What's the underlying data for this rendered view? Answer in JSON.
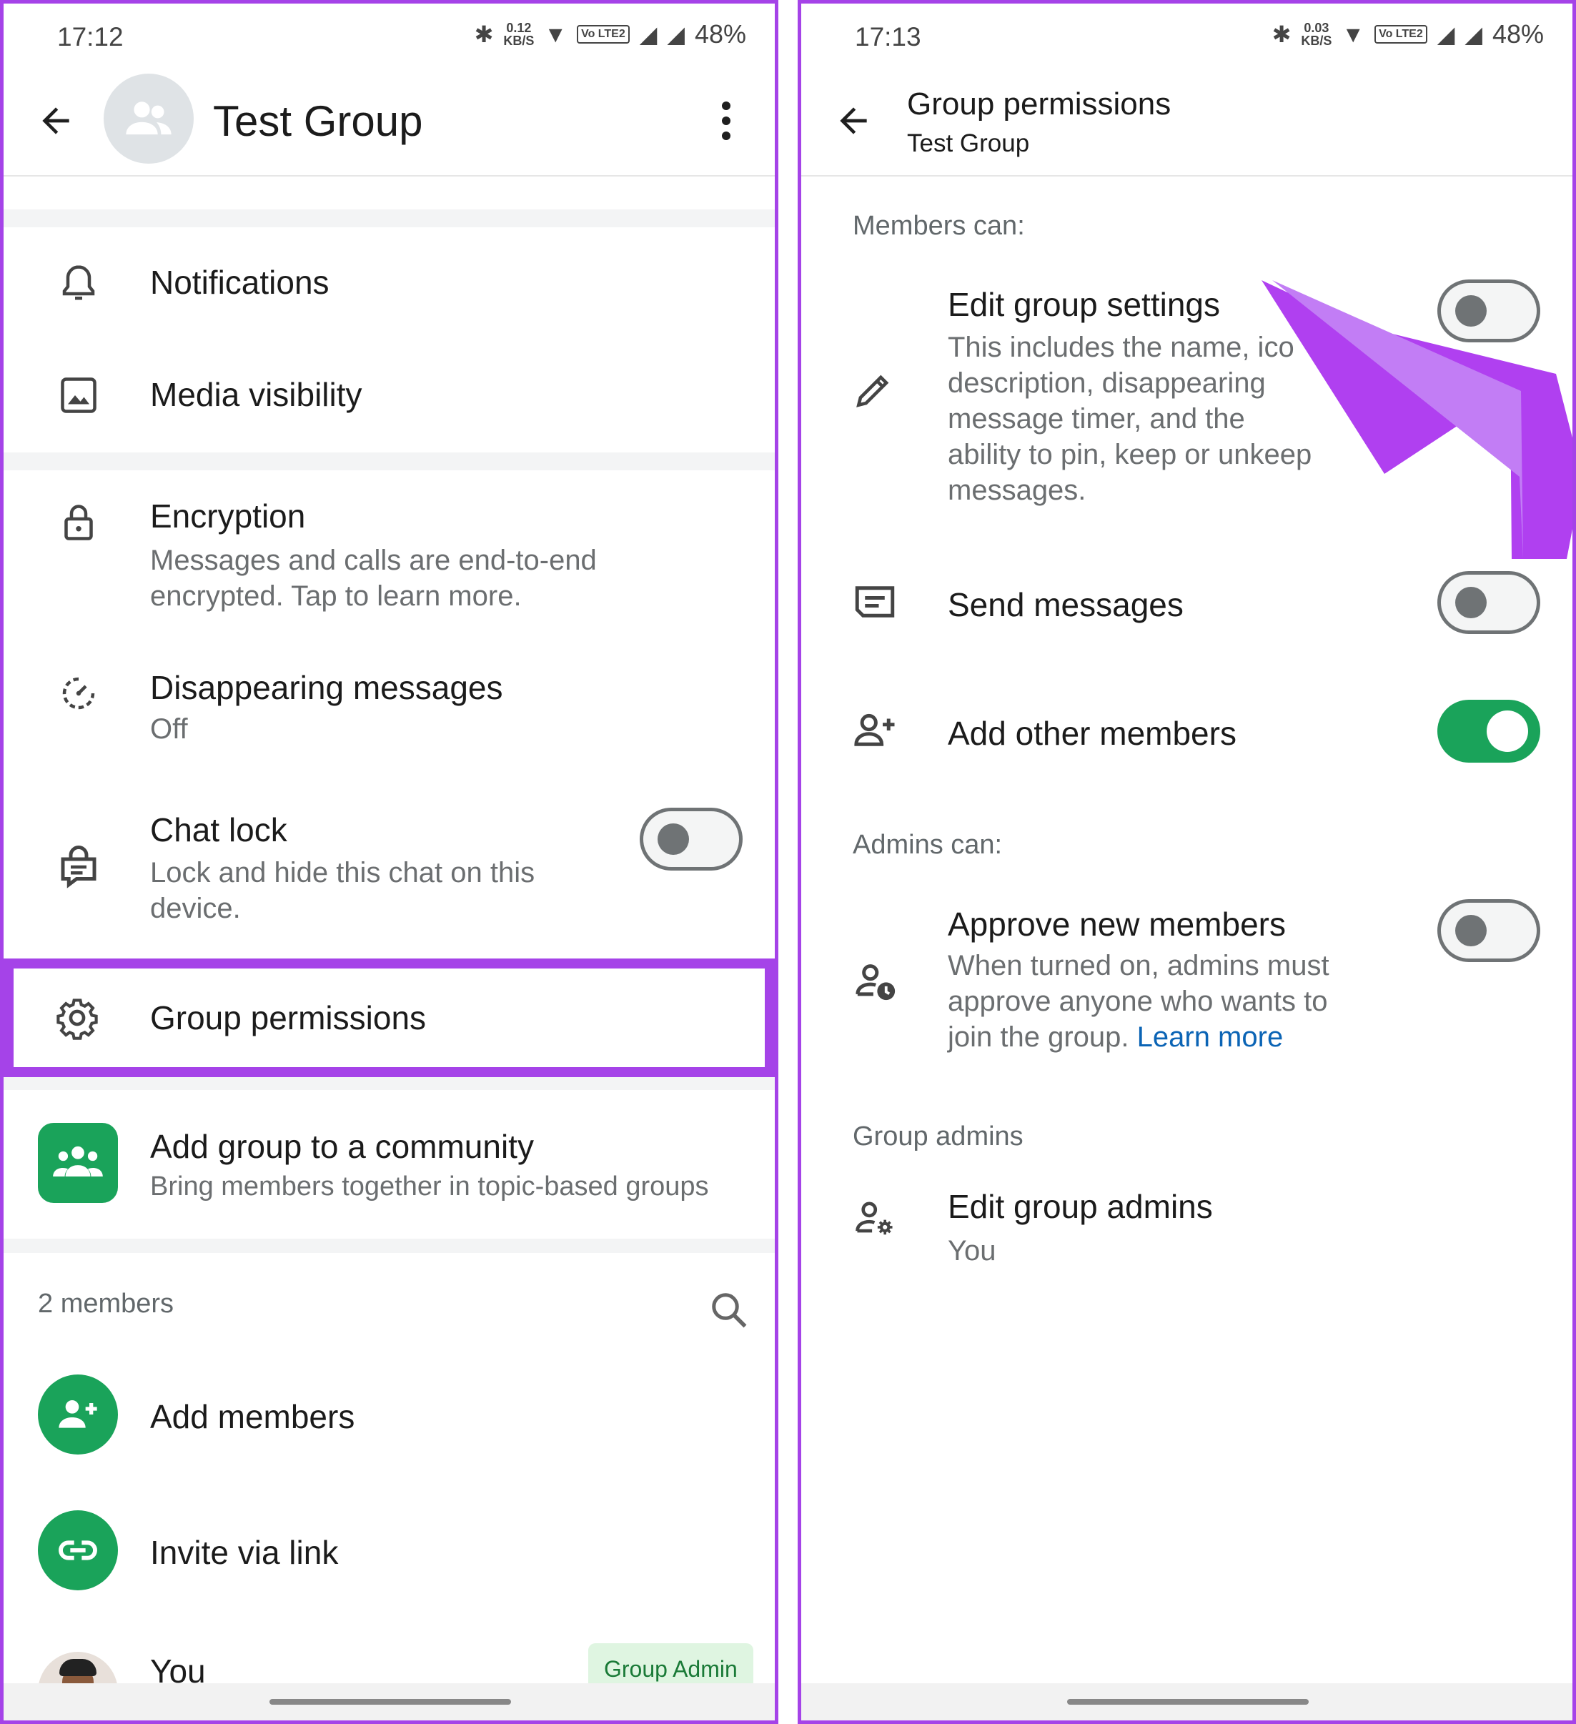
{
  "left": {
    "status": {
      "time": "17:12",
      "rate_top": "0.12",
      "rate_bottom": "KB/S",
      "volte": "Vo LTE2",
      "battery": "48%"
    },
    "header": {
      "title": "Test Group"
    },
    "rows": {
      "notifications": {
        "title": "Notifications"
      },
      "media": {
        "title": "Media visibility"
      },
      "encryption": {
        "title": "Encryption",
        "sub_1": "Messages and calls are end-to-end",
        "sub_2": "encrypted. Tap to learn more."
      },
      "disappearing": {
        "title": "Disappearing messages",
        "sub": "Off"
      },
      "chat_lock": {
        "title": "Chat lock",
        "sub_1": "Lock and hide this chat on this",
        "sub_2": "device.",
        "toggle": false
      },
      "group_permissions": {
        "title": "Group permissions"
      },
      "community": {
        "title": "Add group to a community",
        "sub": "Bring members together in topic-based groups"
      }
    },
    "members": {
      "count_label": "2 members",
      "add_members": "Add members",
      "invite": "Invite via link",
      "you": "You",
      "admin_badge": "Group Admin"
    }
  },
  "right": {
    "status": {
      "time": "17:13",
      "rate_top": "0.03",
      "rate_bottom": "KB/S",
      "volte": "Vo LTE2",
      "battery": "48%"
    },
    "header": {
      "title": "Group permissions",
      "subtitle": "Test Group"
    },
    "members_can_label": "Members can:",
    "edit_settings": {
      "title": "Edit group settings",
      "sub_1": "This includes the name, ico",
      "sub_2": "description, disappearing",
      "sub_3": "message timer, and the",
      "sub_4": "ability to pin, keep or unkeep",
      "sub_5": "messages.",
      "toggle": false
    },
    "send_messages": {
      "title": "Send messages",
      "toggle": false
    },
    "add_other_members": {
      "title": "Add other members",
      "toggle": true
    },
    "admins_can_label": "Admins can:",
    "approve": {
      "title": "Approve new members",
      "sub_1": "When turned on, admins must",
      "sub_2": "approve anyone who wants to",
      "sub_3": "join the group.",
      "link": "Learn more",
      "toggle": false
    },
    "group_admins_label": "Group admins",
    "edit_admins": {
      "title": "Edit group admins",
      "sub": "You"
    }
  },
  "colors": {
    "accent_purple": "#a543e8",
    "whatsapp_green": "#1aa35a",
    "link_blue": "#0b64b5"
  }
}
